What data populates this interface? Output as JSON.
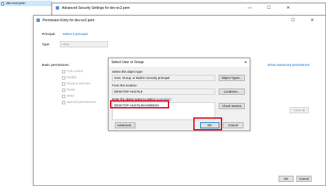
{
  "explorer": {
    "file_item": "dev-ec2.pem"
  },
  "adv_window": {
    "title": "Advanced Security Settings for dev-ec2.pem"
  },
  "perm_window": {
    "title": "Permission Entry for dev-ec2.pem",
    "principal_label": "Principal:",
    "principal_link": "Select a principal",
    "type_label": "Type:",
    "type_value": "Allow",
    "basic_permissions_label": "Basic permissions:",
    "show_advanced_link": "Show advanced permissions",
    "permissions": [
      "Full control",
      "Modify",
      "Read & execute",
      "Read",
      "Write",
      "Special permissions"
    ],
    "clear_all": "Clear all",
    "ok": "OK",
    "cancel": "Cancel"
  },
  "select_dialog": {
    "title": "Select User or Group",
    "object_type_label": "Select this object type:",
    "object_type_value": "User, Group, or Built-in security principal",
    "object_types_button": "Object Types...",
    "location_label": "From this location:",
    "location_value": "DESKTOP-AKG7IL9",
    "locations_button": "Locations...",
    "names_label": "Enter the object name to select",
    "names_label_link": "(examples)",
    "names_label_suffix": ":",
    "names_value": "DESKTOP-AKG7IL9\\HAWEESH",
    "check_names_button": "Check Names",
    "advanced_button": "Advanced...",
    "ok_button": "OK",
    "cancel_button": "Cancel",
    "close_glyph": "×"
  },
  "window_controls": {
    "minimize": "—",
    "maximize": "☐",
    "close": "✕"
  },
  "colors": {
    "highlight": "#d8162a",
    "link": "#0066cc"
  }
}
